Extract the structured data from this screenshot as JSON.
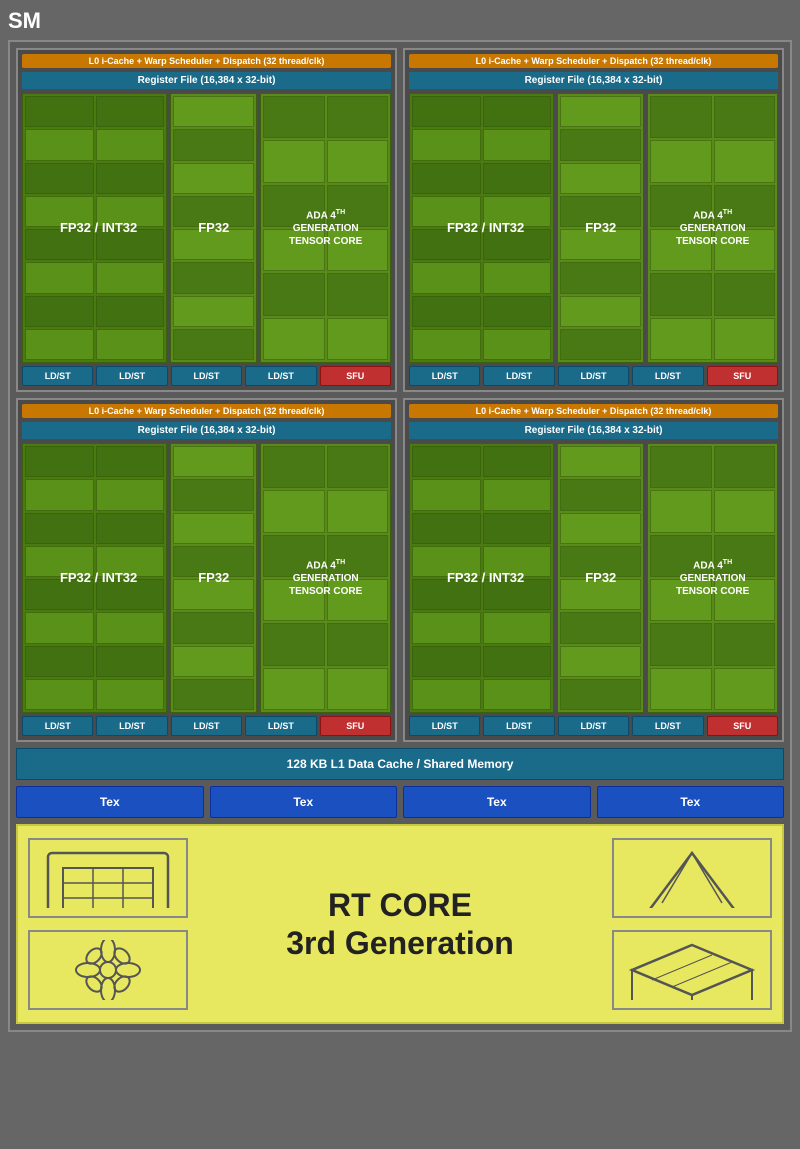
{
  "sm": {
    "label": "SM",
    "l0_cache_label": "L0 i-Cache + Warp Scheduler + Dispatch (32 thread/clk)",
    "register_file_label": "Register File (16,384 x 32-bit)",
    "fp32_int32_label": "FP32\n/\nINT32",
    "fp32_label": "FP32",
    "tensor_label_line1": "ADA 4",
    "tensor_sup": "th",
    "tensor_label_line2": "GENERATION",
    "tensor_label_line3": "TENSOR CORE",
    "ldst_labels": [
      "LD/ST",
      "LD/ST",
      "LD/ST",
      "LD/ST"
    ],
    "sfu_label": "SFU",
    "l1_cache_label": "128 KB L1 Data Cache / Shared Memory",
    "tex_labels": [
      "Tex",
      "Tex",
      "Tex",
      "Tex"
    ],
    "rt_core_title": "RT CORE",
    "rt_core_subtitle": "3rd Generation"
  }
}
